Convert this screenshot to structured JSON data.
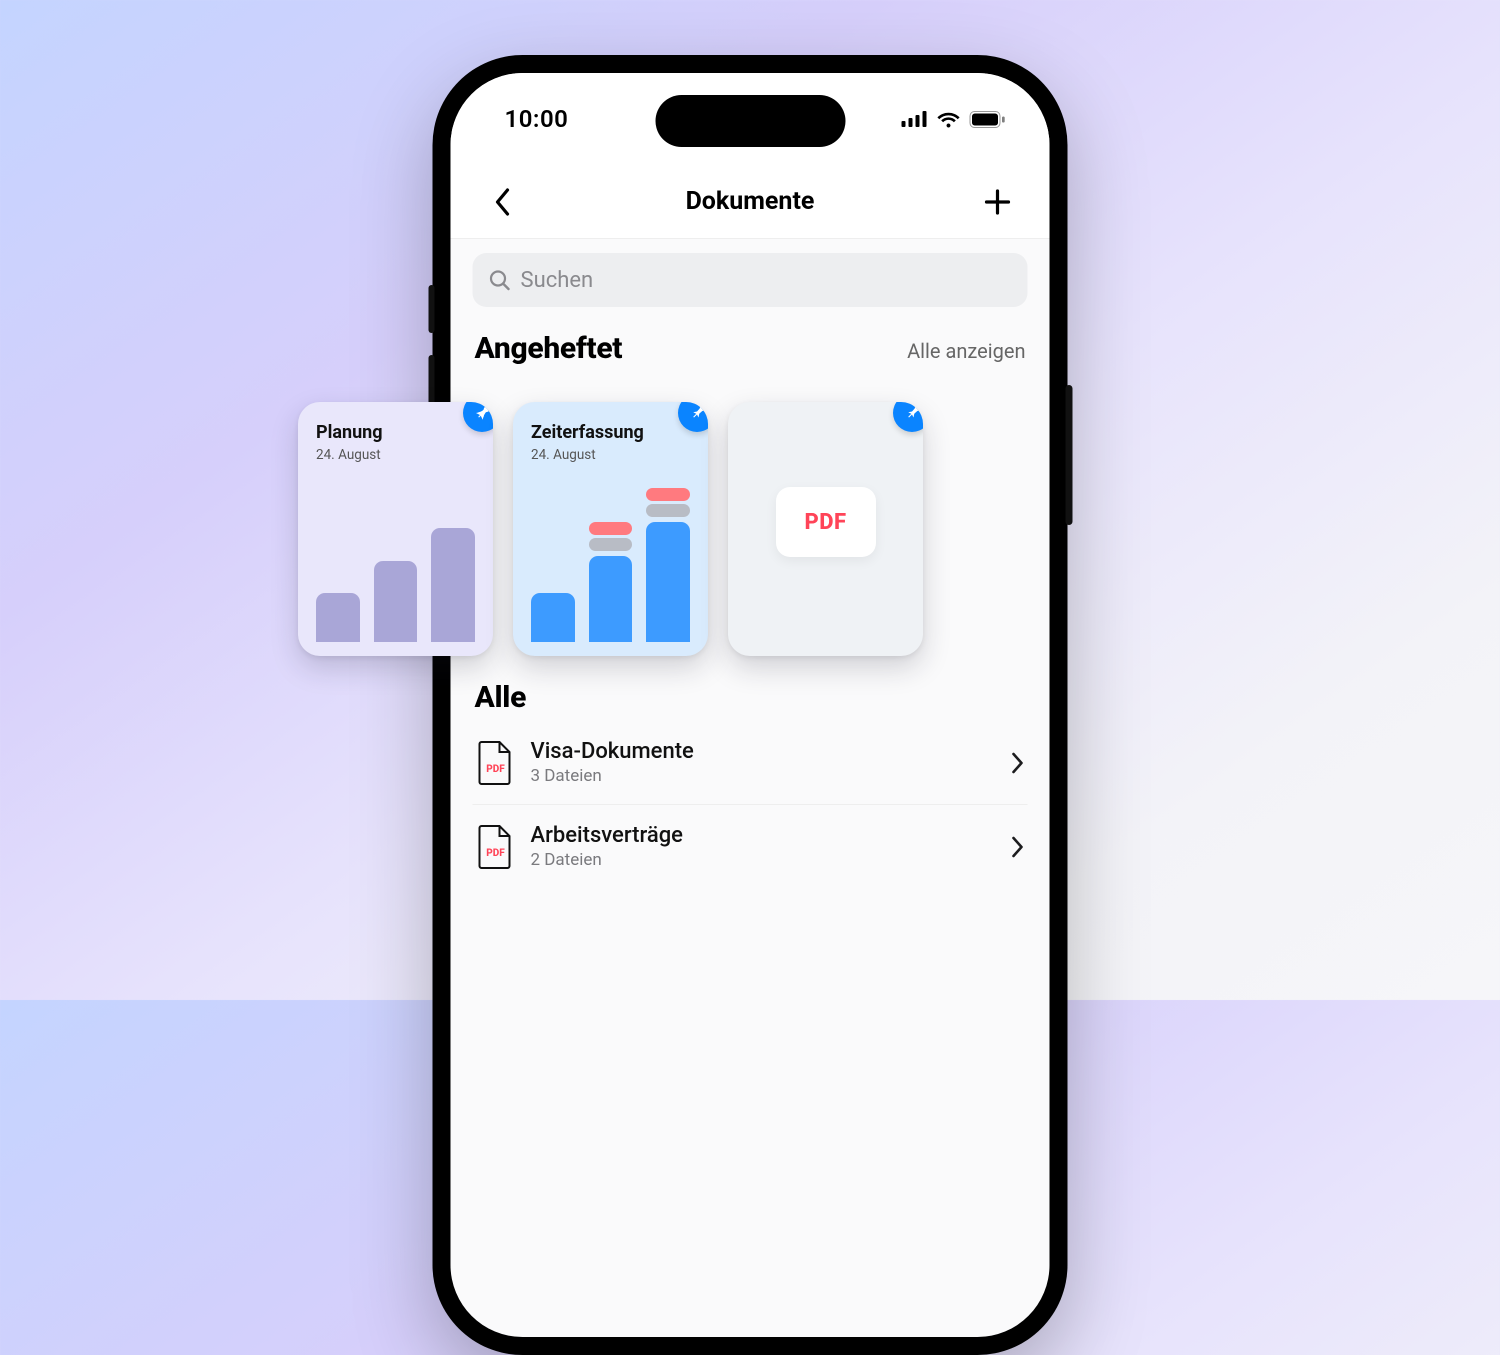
{
  "status": {
    "time": "10:00"
  },
  "nav": {
    "title": "Dokumente"
  },
  "search": {
    "placeholder": "Suchen"
  },
  "pinned": {
    "heading": "Angeheftet",
    "show_all": "Alle anzeigen",
    "cards": [
      {
        "title": "Planung",
        "subtitle": "24. August"
      },
      {
        "title": "Zeiterfassung",
        "subtitle": "24. August"
      },
      {
        "title": "",
        "subtitle": "",
        "pdf_label": "PDF"
      }
    ]
  },
  "all": {
    "heading": "Alle",
    "items": [
      {
        "title": "Visa-Dokumente",
        "subtitle": "3 Dateien",
        "badge": "PDF"
      },
      {
        "title": "Arbeitsverträge",
        "subtitle": "2 Dateien",
        "badge": "PDF"
      }
    ]
  }
}
